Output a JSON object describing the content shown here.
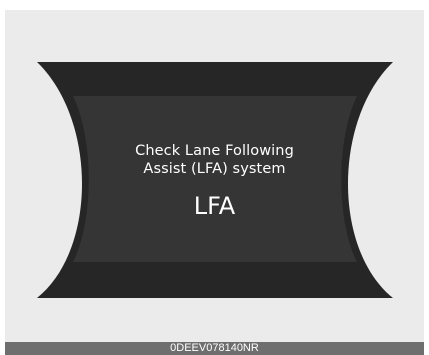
{
  "display": {
    "message_line_1": "Check Lane Following",
    "message_line_2": "Assist (LFA) system",
    "feature_label": "LFA",
    "colors": {
      "panel_background": "#ebebeb",
      "display_outer": "#262626",
      "display_inner": "#353535",
      "text": "#ffffff",
      "caption_bar": "#6e6e6e"
    }
  },
  "caption": {
    "code": "0DEEV078140NR"
  }
}
